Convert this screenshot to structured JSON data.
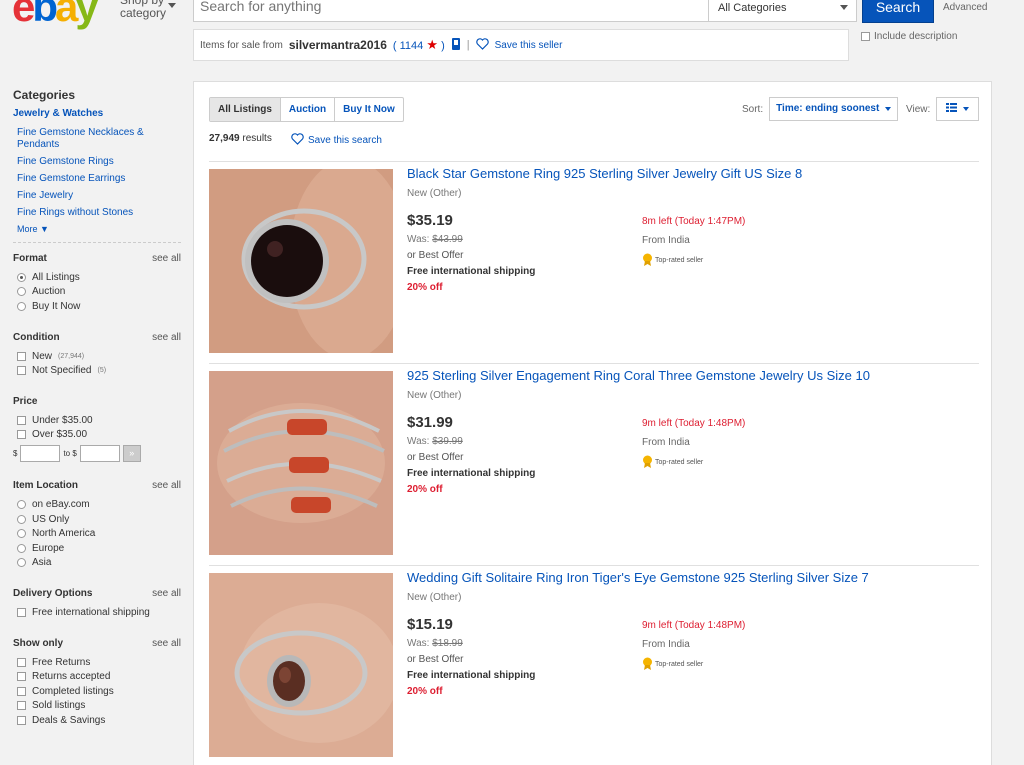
{
  "header": {
    "logo": {
      "e": "e",
      "b": "b",
      "a": "a",
      "y": "y"
    },
    "shop_by": "Shop by category",
    "search_placeholder": "Search for anything",
    "category_select": "All Categories",
    "search_button": "Search",
    "advanced": "Advanced",
    "include_description": "Include description"
  },
  "seller_bar": {
    "label": "Items for sale from",
    "seller_name": "silvermantra2016",
    "feedback_open": "(",
    "feedback_score": "1144",
    "feedback_close": ")",
    "separator": "|",
    "save_seller": "Save this seller"
  },
  "sidebar": {
    "categories_title": "Categories",
    "main_category": "Jewelry & Watches",
    "categories": [
      "Fine Gemstone Necklaces & Pendants",
      "Fine Gemstone Rings",
      "Fine Gemstone Earrings",
      "Fine Jewelry",
      "Fine Rings without Stones"
    ],
    "more": "More",
    "see_all": "see all",
    "format": {
      "title": "Format",
      "options": [
        "All Listings",
        "Auction",
        "Buy It Now"
      ]
    },
    "condition": {
      "title": "Condition",
      "options": [
        {
          "label": "New",
          "count": "(27,944)"
        },
        {
          "label": "Not Specified",
          "count": "(5)"
        }
      ]
    },
    "price": {
      "title": "Price",
      "options": [
        "Under $35.00",
        "Over $35.00"
      ],
      "from_label": "$",
      "to_label": "to $",
      "go": "»"
    },
    "item_location": {
      "title": "Item Location",
      "options": [
        "on eBay.com",
        "US Only",
        "North America",
        "Europe",
        "Asia"
      ]
    },
    "delivery": {
      "title": "Delivery Options",
      "options": [
        "Free international shipping"
      ]
    },
    "show_only": {
      "title": "Show only",
      "options": [
        "Free Returns",
        "Returns accepted",
        "Completed listings",
        "Sold listings",
        "Deals & Savings"
      ]
    }
  },
  "main": {
    "tabs": [
      "All Listings",
      "Auction",
      "Buy It Now"
    ],
    "results_count": "27,949",
    "results_label": "results",
    "save_search": "Save this search",
    "sort_label": "Sort:",
    "sort_value": "Time: ending soonest",
    "view_label": "View:"
  },
  "listings": [
    {
      "title": "Black Star Gemstone Ring 925 Sterling Silver Jewelry Gift US Size 8",
      "condition": "New (Other)",
      "price": "$35.19",
      "was_label": "Was:",
      "was_price": "$43.99",
      "best_offer": "or Best Offer",
      "shipping": "Free international shipping",
      "discount": "20% off",
      "time_left": "8m left (Today 1:47PM)",
      "from": "From India",
      "top_rated": "Top-rated seller"
    },
    {
      "title": "925 Sterling Silver Engagement Ring Coral Three Gemstone Jewelry Us Size 10",
      "condition": "New (Other)",
      "price": "$31.99",
      "was_label": "Was:",
      "was_price": "$39.99",
      "best_offer": "or Best Offer",
      "shipping": "Free international shipping",
      "discount": "20% off",
      "time_left": "9m left (Today 1:48PM)",
      "from": "From India",
      "top_rated": "Top-rated seller"
    },
    {
      "title": "Wedding Gift Solitaire Ring Iron Tiger's Eye Gemstone 925 Sterling Silver Size 7",
      "condition": "New (Other)",
      "price": "$15.19",
      "was_label": "Was:",
      "was_price": "$18.99",
      "best_offer": "or Best Offer",
      "shipping": "Free international shipping",
      "discount": "20% off",
      "time_left": "9m left (Today 1:48PM)",
      "from": "From India",
      "top_rated": "Top-rated seller"
    }
  ],
  "colors": {
    "link": "#0654ba",
    "search_button": "#0654ba",
    "urgent": "#dd1e31",
    "logo_e": "#e53238",
    "logo_b": "#0064d2",
    "logo_a": "#f5af02",
    "logo_y": "#86b817"
  }
}
